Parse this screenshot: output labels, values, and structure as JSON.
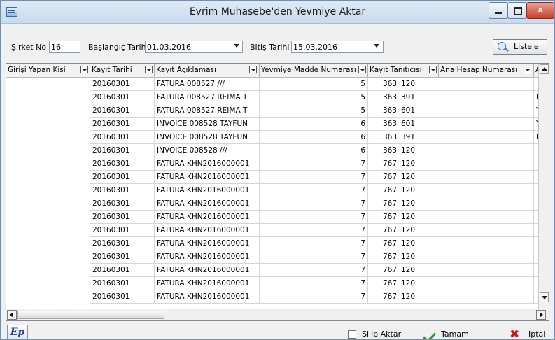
{
  "window": {
    "title": "Evrim Muhasebe'den Yevmiye Aktar"
  },
  "filters": {
    "sirket_label": "Şirket No",
    "sirket_value": "16",
    "baslangic_label": "Başlangıç Tarihi",
    "baslangic_value": "01.03.2016",
    "bitis_label": "Bitiş Tarihi",
    "bitis_value": "15.03.2016",
    "listele_label": "Listele"
  },
  "grid": {
    "columns": [
      "Girişi Yapan Kişi",
      "Kayıt Tarihi",
      "Kayıt Açıklaması",
      "Yevmiye Madde Numarası",
      "Kayıt Tanıtıcısı",
      "Ana Hesap Numarası",
      "A"
    ],
    "rows": [
      [
        "",
        "20160301",
        "FATURA 008527 ///",
        "5",
        "363",
        "120",
        ""
      ],
      [
        "",
        "20160301",
        "FATURA 008527 REIMA T",
        "5",
        "363",
        "391",
        "H"
      ],
      [
        "",
        "20160301",
        "FATURA 008527 REIMA T",
        "5",
        "363",
        "601",
        "Y"
      ],
      [
        "",
        "20160301",
        "INVOICE 008528 TAYFUN",
        "6",
        "363",
        "601",
        "Y"
      ],
      [
        "",
        "20160301",
        "INVOICE 008528 TAYFUN",
        "6",
        "363",
        "391",
        "H"
      ],
      [
        "",
        "20160301",
        "INVOICE 008528 ///",
        "6",
        "363",
        "120",
        ""
      ],
      [
        "",
        "20160301",
        "FATURA KHN2016000001",
        "7",
        "767",
        "120",
        ""
      ],
      [
        "",
        "20160301",
        "FATURA KHN2016000001",
        "7",
        "767",
        "120",
        ""
      ],
      [
        "",
        "20160301",
        "FATURA KHN2016000001",
        "7",
        "767",
        "120",
        ""
      ],
      [
        "",
        "20160301",
        "FATURA KHN2016000001",
        "7",
        "767",
        "120",
        ""
      ],
      [
        "",
        "20160301",
        "FATURA KHN2016000001",
        "7",
        "767",
        "120",
        ""
      ],
      [
        "",
        "20160301",
        "FATURA KHN2016000001",
        "7",
        "767",
        "120",
        ""
      ],
      [
        "",
        "20160301",
        "FATURA KHN2016000001",
        "7",
        "767",
        "120",
        ""
      ],
      [
        "",
        "20160301",
        "FATURA KHN2016000001",
        "7",
        "767",
        "120",
        ""
      ],
      [
        "",
        "20160301",
        "FATURA KHN2016000001",
        "7",
        "767",
        "120",
        ""
      ],
      [
        "",
        "20160301",
        "FATURA KHN2016000001",
        "7",
        "767",
        "120",
        ""
      ],
      [
        "",
        "20160301",
        "FATURA KHN2016000001",
        "7",
        "767",
        "120",
        ""
      ]
    ]
  },
  "footer": {
    "logo_text": "Ep",
    "silip_aktar_label": "Silip Aktar",
    "tamam_label": "Tamam",
    "iptal_label": "İptal"
  },
  "icons": [
    "app-icon",
    "minimize-icon",
    "maximize-icon",
    "close-icon",
    "search-icon",
    "dropdown-icon",
    "check-icon",
    "cross-icon",
    "scroll-up-icon",
    "scroll-down-icon",
    "scroll-left-icon",
    "scroll-right-icon"
  ]
}
